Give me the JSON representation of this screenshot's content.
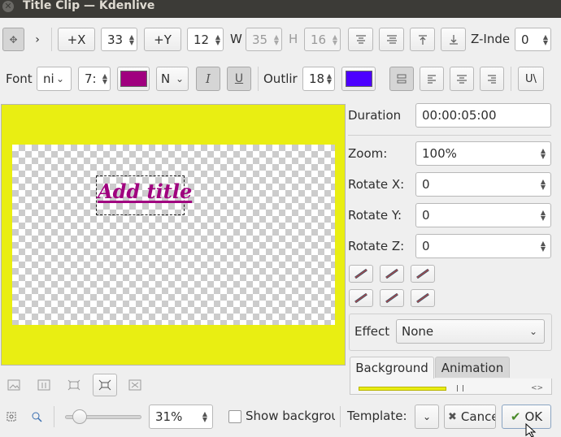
{
  "window": {
    "title": "Title Clip — Kdenlive"
  },
  "toolbar1": {
    "x_button": "+X",
    "x_value": "33",
    "y_button": "+Y",
    "y_value": "12",
    "w_label": "W",
    "w_value": "35",
    "h_label": "H",
    "h_value": "16",
    "z_label": "Z-Inde",
    "z_value": "0"
  },
  "toolbar2": {
    "font_label": "Font",
    "font_value": "ni",
    "size_value": "7:",
    "font_color": "#a0007f",
    "weight_value": "N",
    "italic_glyph": "I",
    "underline_glyph": "U",
    "outline_label": "Outlir",
    "outline_value": "18",
    "outline_color": "#4c00ff",
    "uppercase_label": "U\\"
  },
  "canvas": {
    "background_color": "#e9ee12",
    "title_text": "Add title",
    "title_color": "#a0007f"
  },
  "properties": {
    "duration_label": "Duration",
    "duration_value": "00:00:05:00",
    "zoom_label": "Zoom:",
    "zoom_value": "100%",
    "rotate_x_label": "Rotate X:",
    "rotate_x_value": "0",
    "rotate_y_label": "Rotate Y:",
    "rotate_y_value": "0",
    "rotate_z_label": "Rotate Z:",
    "rotate_z_value": "0",
    "effect_label": "Effect",
    "effect_value": "None"
  },
  "tabs": {
    "background": "Background",
    "animation": "Animation"
  },
  "bottom": {
    "zoom_percent": "31%",
    "zoom_slider_level": 0.1,
    "show_background_label": "Show backgrou",
    "template_label": "Template:",
    "cancel_label": "Cance",
    "ok_label": "OK"
  }
}
